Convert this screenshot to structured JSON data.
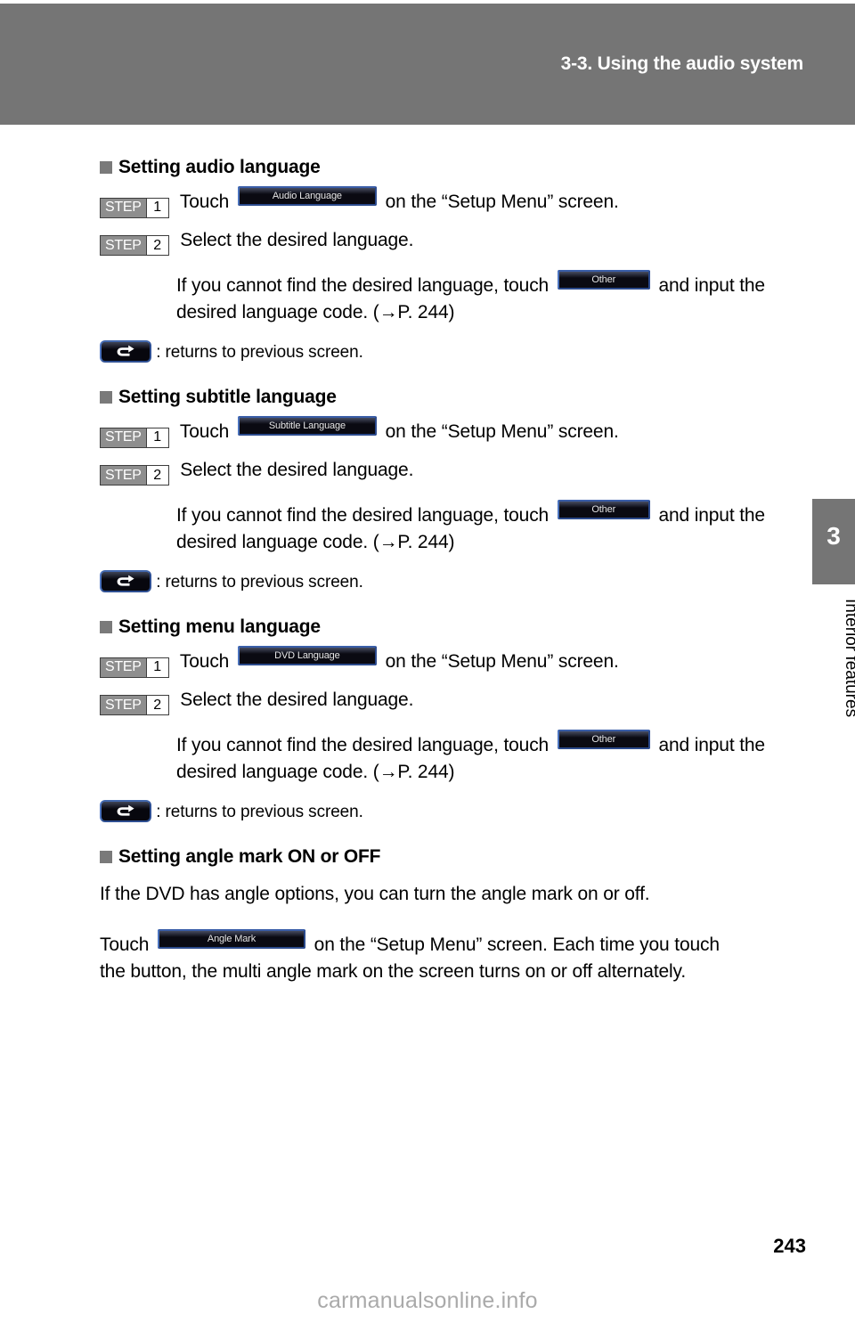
{
  "header": {
    "title": "3-3. Using the audio system"
  },
  "chapter_tab": {
    "number": "3",
    "label": "Interior features"
  },
  "sections": [
    {
      "heading": "Setting audio language",
      "step1_badge_word": "STEP",
      "step1_badge_num": "1",
      "step1_pre": "Touch",
      "step1_button": "Audio Language",
      "step1_post": "on the “Setup Menu” screen.",
      "step2_badge_word": "STEP",
      "step2_badge_num": "2",
      "step2_text": "Select the desired language.",
      "note_pre": "If you cannot find the desired language, touch",
      "note_button": "Other",
      "note_post": "and input the",
      "note_line2": "desired language code. (→P. 244)",
      "returns_text": ":  returns to previous screen."
    },
    {
      "heading": "Setting subtitle language",
      "step1_badge_word": "STEP",
      "step1_badge_num": "1",
      "step1_pre": "Touch",
      "step1_button": "Subtitle Language",
      "step1_post": "on the “Setup Menu” screen.",
      "step2_badge_word": "STEP",
      "step2_badge_num": "2",
      "step2_text": "Select the desired language.",
      "note_pre": "If you cannot find the desired language, touch",
      "note_button": "Other",
      "note_post": "and input the",
      "note_line2": "desired language code. (→P. 244)",
      "returns_text": ":  returns to previous screen."
    },
    {
      "heading": "Setting menu language",
      "step1_badge_word": "STEP",
      "step1_badge_num": "1",
      "step1_pre": "Touch",
      "step1_button": "DVD Language",
      "step1_post": "on the “Setup Menu” screen.",
      "step2_badge_word": "STEP",
      "step2_badge_num": "2",
      "step2_text": "Select the desired language.",
      "note_pre": "If you cannot find the desired language, touch",
      "note_button": "Other",
      "note_post": "and input the",
      "note_line2": "desired language code. (→P. 244)",
      "returns_text": ":  returns to previous screen."
    }
  ],
  "angle_section": {
    "heading": "Setting angle mark ON or OFF",
    "intro": "If the DVD has angle options, you can turn the angle mark on or off.",
    "touch_pre": "Touch",
    "touch_button": "Angle Mark",
    "touch_post": "on the “Setup Menu” screen. Each time you touch",
    "touch_line2": "the button, the multi angle mark on the screen turns on or off alternately."
  },
  "footer": {
    "page_number": "243",
    "watermark": "carmanualsonline.info"
  },
  "colors": {
    "header_gray": "#757575",
    "tab_gray": "#757575",
    "step_gray": "#8e8e8e",
    "button_bezel_blue": "#2b4a8c",
    "button_face_black": "#0a0a12",
    "watermark_gray": "#aaaaaa"
  }
}
